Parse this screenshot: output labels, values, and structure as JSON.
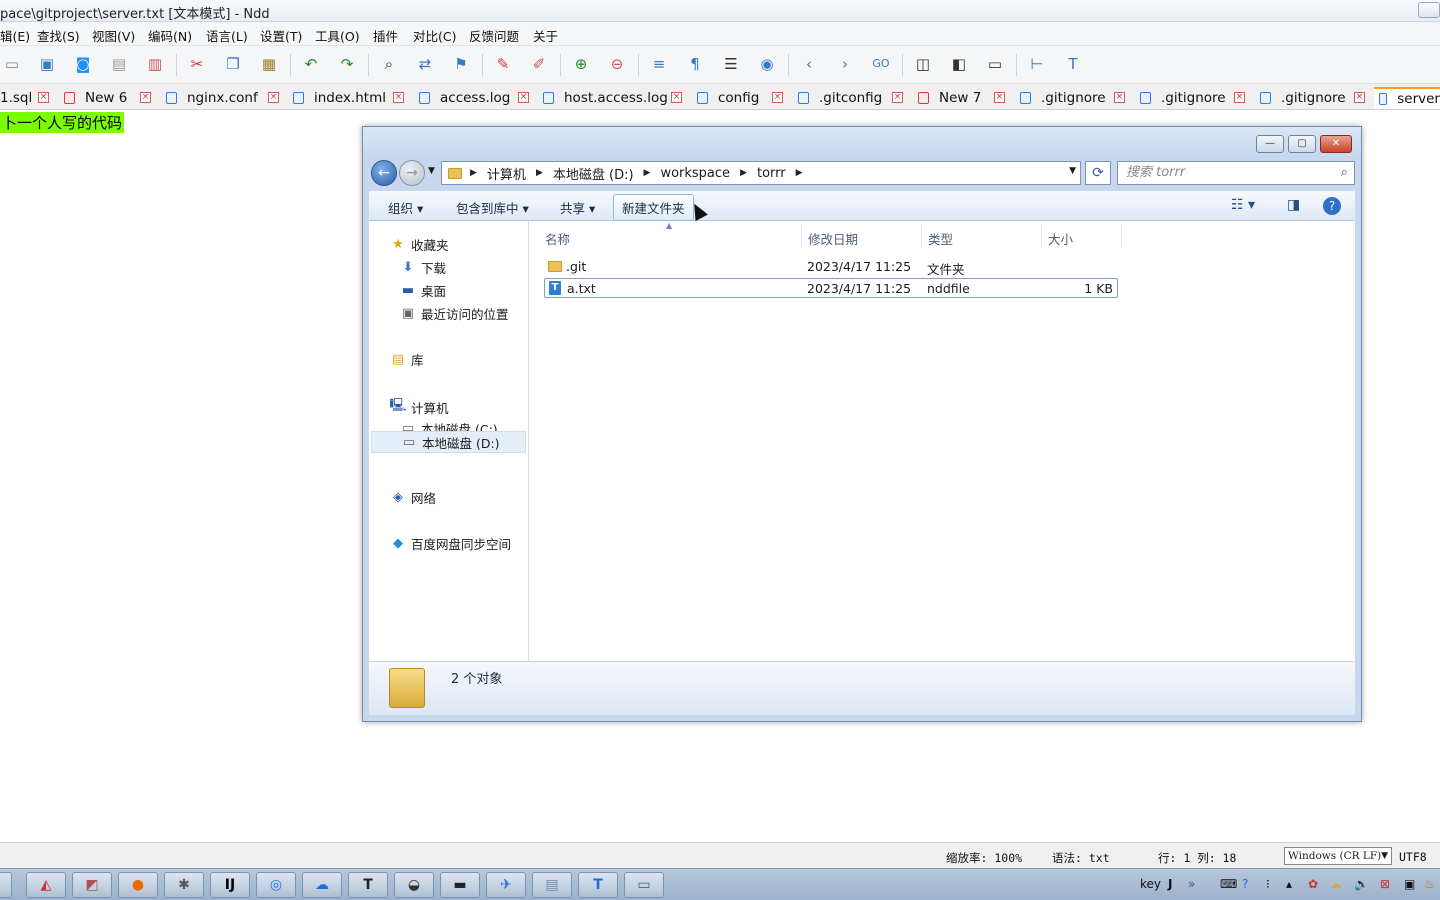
{
  "app": {
    "title": "pace\\gitproject\\server.txt [文本模式] - Ndd"
  },
  "menu": [
    "辑(E)",
    "查找(S)",
    "视图(V)",
    "编码(N)",
    "语言(L)",
    "设置(T)",
    "工具(O)",
    "插件",
    "对比(C)",
    "反馈问题",
    "关于"
  ],
  "toolbar_icons": [
    "save-icon",
    "save-all-icon",
    "sync-icon",
    "open-icon",
    "close-file-icon",
    "cut-icon",
    "copy-icon",
    "paste-icon",
    "undo-icon",
    "redo-icon",
    "find-icon",
    "replace-icon",
    "bookmark-icon",
    "mark-red-icon",
    "clear-mark-icon",
    "zoom-in-icon",
    "zoom-out-icon",
    "word-wrap-icon",
    "show-symbols-icon",
    "indent-guide-icon",
    "record-icon",
    "prev-icon",
    "next-icon",
    "goto-icon",
    "compare-icon",
    "split-icon",
    "monitor-icon",
    "tree-icon",
    "text-icon"
  ],
  "tabs": [
    {
      "label": "1.sql",
      "kind": "blue"
    },
    {
      "label": "New 6",
      "kind": "red"
    },
    {
      "label": "nginx.conf",
      "kind": "blue"
    },
    {
      "label": "index.html",
      "kind": "blue"
    },
    {
      "label": "access.log",
      "kind": "blue"
    },
    {
      "label": "host.access.log",
      "kind": "blue"
    },
    {
      "label": "config",
      "kind": "blue"
    },
    {
      "label": ".gitconfig",
      "kind": "blue"
    },
    {
      "label": "New 7",
      "kind": "red"
    },
    {
      "label": ".gitignore",
      "kind": "blue"
    },
    {
      "label": ".gitignore",
      "kind": "blue"
    },
    {
      "label": ".gitignore",
      "kind": "blue"
    },
    {
      "label": "server",
      "kind": "blue"
    }
  ],
  "editor": {
    "line1": "卜一个人写的代码"
  },
  "explorer": {
    "caption_buttons": {
      "minimize": "—",
      "maximize": "▢",
      "close": "✕"
    },
    "breadcrumb": [
      "计算机",
      "本地磁盘 (D:)",
      "workspace",
      "torrr"
    ],
    "search_placeholder": "搜索 torrr",
    "commands": {
      "organize": "组织 ▾",
      "include_library": "包含到库中 ▾",
      "share": "共享 ▾",
      "new_folder": "新建文件夹"
    },
    "nav": {
      "favorites": "收藏夹",
      "downloads": "下载",
      "desktop": "桌面",
      "recent": "最近访问的位置",
      "library": "库",
      "computer": "计算机",
      "drive_c": "本地磁盘 (C:)",
      "drive_d": "本地磁盘 (D:)",
      "network": "网络",
      "baidu": "百度网盘同步空间"
    },
    "columns": {
      "name": "名称",
      "modified": "修改日期",
      "type": "类型",
      "size": "大小"
    },
    "files": [
      {
        "name": ".git",
        "modified": "2023/4/17 11:25",
        "type": "文件夹",
        "size": ""
      },
      {
        "name": "a.txt",
        "modified": "2023/4/17 11:25",
        "type": "nddfile",
        "size": "1 KB"
      }
    ],
    "status_count": "2 个对象"
  },
  "statusbar": {
    "zoom": "缩放率: 100%",
    "syntax": "语法: txt",
    "position": "行: 1 列: 18",
    "eol": "Windows (CR LF)",
    "encoding": "UTF8"
  },
  "taskbar": {
    "tray_text": "key"
  }
}
